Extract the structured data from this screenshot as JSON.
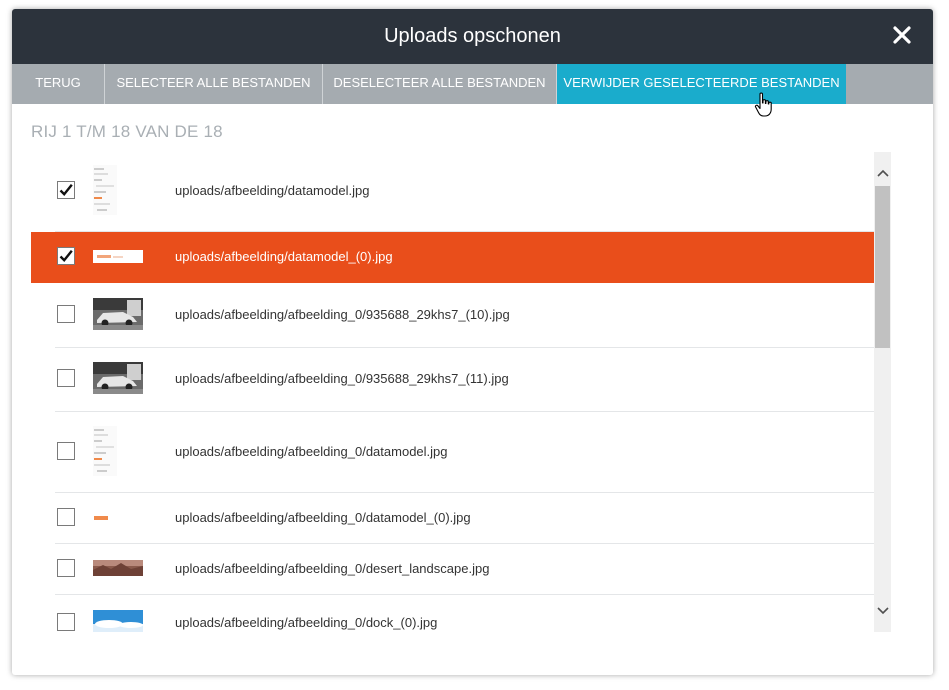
{
  "dialog": {
    "title": "Uploads opschonen"
  },
  "toolbar": {
    "back_label": "TERUG",
    "select_all_label": "SELECTEER ALLE BESTANDEN",
    "deselect_all_label": "DESELECTEER ALLE BESTANDEN",
    "delete_selected_label": "VERWIJDER GESELECTEERDE BESTANDEN"
  },
  "summary": "RIJ 1 T/M 18 VAN DE 18",
  "files": [
    {
      "path": "uploads/afbeelding/datamodel.jpg",
      "checked": true,
      "selected": false,
      "thumb": "document"
    },
    {
      "path": "uploads/afbeelding/datamodel_(0).jpg",
      "checked": true,
      "selected": true,
      "thumb": "banner"
    },
    {
      "path": "uploads/afbeelding/afbeelding_0/935688_29khs7_(10).jpg",
      "checked": false,
      "selected": false,
      "thumb": "car"
    },
    {
      "path": "uploads/afbeelding/afbeelding_0/935688_29khs7_(11).jpg",
      "checked": false,
      "selected": false,
      "thumb": "car"
    },
    {
      "path": "uploads/afbeelding/afbeelding_0/datamodel.jpg",
      "checked": false,
      "selected": false,
      "thumb": "document"
    },
    {
      "path": "uploads/afbeelding/afbeelding_0/datamodel_(0).jpg",
      "checked": false,
      "selected": false,
      "thumb": "small-banner"
    },
    {
      "path": "uploads/afbeelding/afbeelding_0/desert_landscape.jpg",
      "checked": false,
      "selected": false,
      "thumb": "desert"
    },
    {
      "path": "uploads/afbeelding/afbeelding_0/dock_(0).jpg",
      "checked": false,
      "selected": false,
      "thumb": "sky"
    }
  ],
  "colors": {
    "titlebar": "#2c333c",
    "toolbar": "#a5abb0",
    "active_button": "#1aaccc",
    "selected_row": "#e94e1b"
  },
  "icons": [
    "close-icon",
    "checkmark-icon",
    "chevron-up-icon",
    "chevron-down-icon",
    "hand-pointer-icon"
  ]
}
